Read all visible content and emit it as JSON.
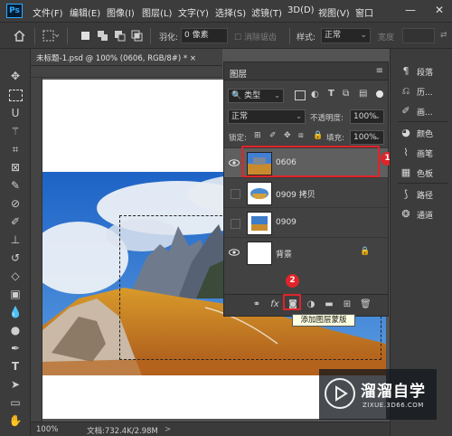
{
  "menubar": {
    "logo": "Ps",
    "items": [
      "文件(F)",
      "编辑(E)",
      "图像(I)",
      "图层(L)",
      "文字(Y)",
      "选择(S)",
      "滤镜(T)",
      "3D(D)",
      "视图(V)",
      "窗口"
    ]
  },
  "options": {
    "feather_label": "羽化:",
    "feather_value": "0 像素",
    "antialias_label": "消除锯齿",
    "style_label": "样式:",
    "style_value": "正常",
    "width_label": "宽度"
  },
  "document": {
    "tab_title": "未标题-1.psd @ 100% (0606, RGB/8#) *",
    "close": "×"
  },
  "status": {
    "zoom": "100%",
    "doc_info": "文档:732.4K/2.98M"
  },
  "layers_panel": {
    "title": "图层",
    "filter_kind": "类型",
    "blend_mode": "正常",
    "opacity_label": "不透明度:",
    "opacity_value": "100%",
    "lock_label": "锁定:",
    "fill_label": "填充:",
    "fill_value": "100%",
    "layers": [
      {
        "name": "0606",
        "visible": true,
        "selected": true
      },
      {
        "name": "0909 拷贝",
        "visible": false,
        "selected": false
      },
      {
        "name": "0909",
        "visible": false,
        "selected": false
      },
      {
        "name": "背景",
        "visible": true,
        "selected": false,
        "locked": true
      }
    ],
    "footer_icons": [
      "link-icon",
      "fx-icon",
      "add-mask-icon",
      "adjustment-icon",
      "group-icon",
      "new-layer-icon",
      "trash-icon"
    ],
    "tooltip": "添加图层蒙版"
  },
  "annotations": {
    "step1": "1",
    "step2": "2",
    "highlight_color": "#e0242a"
  },
  "right_panels": [
    {
      "icon": "paragraph-icon",
      "label": "段落"
    },
    {
      "icon": "history-icon",
      "label": "历..."
    },
    {
      "icon": "brush-icon",
      "label": "画..."
    },
    {
      "icon": "palette-icon",
      "label": "颜色"
    },
    {
      "icon": "brush-settings-icon",
      "label": "画笔"
    },
    {
      "icon": "swatches-icon",
      "label": "色板"
    },
    {
      "icon": "paths-icon",
      "label": "路径"
    },
    {
      "icon": "channels-icon",
      "label": "通道"
    }
  ],
  "watermark": {
    "title": "溜溜自学",
    "subtitle": "ZIXUE.3D66.COM"
  }
}
